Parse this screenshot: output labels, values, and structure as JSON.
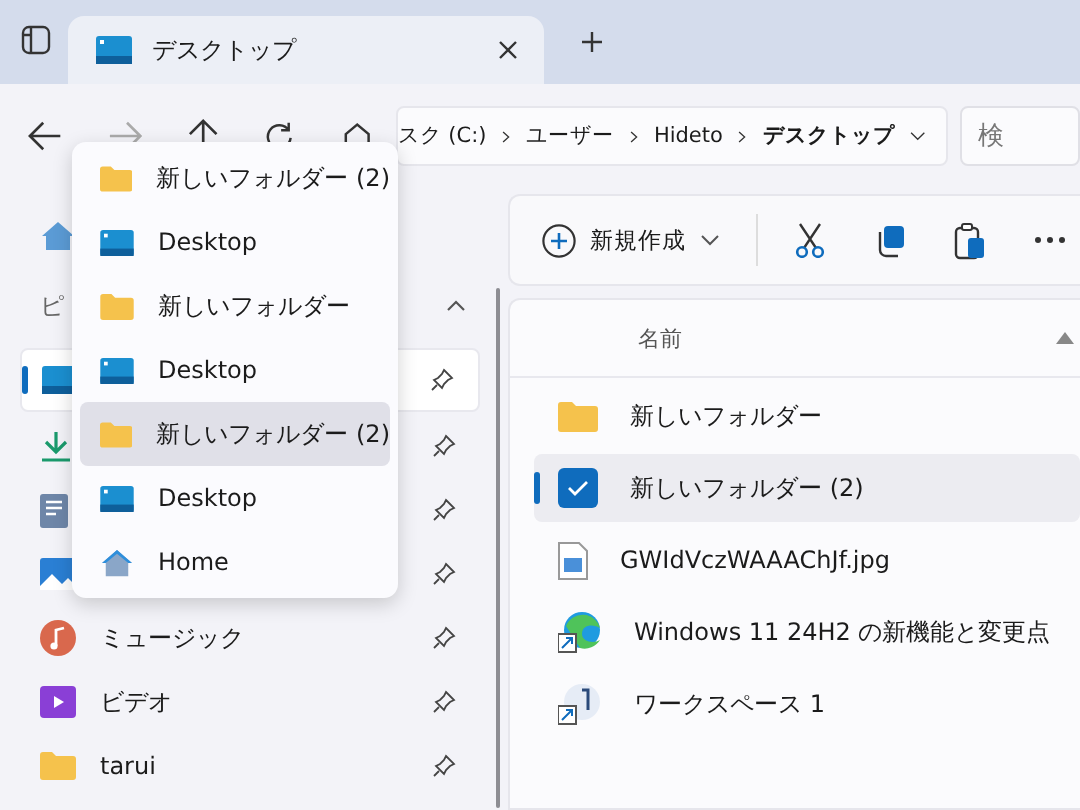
{
  "tab": {
    "title": "デスクトップ"
  },
  "nav": {
    "back_disabled": false,
    "forward_disabled": true
  },
  "address": {
    "segments": [
      "スク (C:)",
      "ユーザー",
      "Hideto",
      "デスクトップ"
    ]
  },
  "search": {
    "placeholder": "検"
  },
  "history_menu": [
    {
      "kind": "folder",
      "label": "新しいフォルダー (2)",
      "selected": false
    },
    {
      "kind": "desktop",
      "label": "Desktop",
      "selected": false
    },
    {
      "kind": "folder",
      "label": "新しいフォルダー",
      "selected": false
    },
    {
      "kind": "desktop",
      "label": "Desktop",
      "selected": false
    },
    {
      "kind": "folder",
      "label": "新しいフォルダー (2)",
      "selected": true
    },
    {
      "kind": "desktop",
      "label": "Desktop",
      "selected": false
    },
    {
      "kind": "home",
      "label": "Home",
      "selected": false
    }
  ],
  "sidebar": {
    "section": "ピ",
    "expanded": true,
    "items": [
      {
        "kind": "desktop",
        "selected": true,
        "pinned": true
      },
      {
        "kind": "download",
        "selected": false,
        "pinned": true
      },
      {
        "kind": "document",
        "selected": false,
        "pinned": true
      },
      {
        "kind": "picture",
        "selected": false,
        "pinned": true
      },
      {
        "kind": "music",
        "label": "ミュージック",
        "selected": false,
        "pinned": true
      },
      {
        "kind": "video",
        "label": "ビデオ",
        "selected": false,
        "pinned": true
      },
      {
        "kind": "folder",
        "label": "tarui",
        "selected": false,
        "pinned": true
      }
    ]
  },
  "commands": {
    "new_label": "新規作成"
  },
  "files": {
    "column": "名前",
    "rows": [
      {
        "kind": "folder",
        "name": "新しいフォルダー",
        "selected": false
      },
      {
        "kind": "folder",
        "name": "新しいフォルダー (2)",
        "selected": true
      },
      {
        "kind": "image",
        "name": "GWIdVczWAAAChJf.jpg",
        "selected": false
      },
      {
        "kind": "edge",
        "name": "Windows 11 24H2 の新機能と変更点",
        "selected": false
      },
      {
        "kind": "workspace",
        "name": "ワークスペース 1",
        "selected": false
      }
    ]
  }
}
